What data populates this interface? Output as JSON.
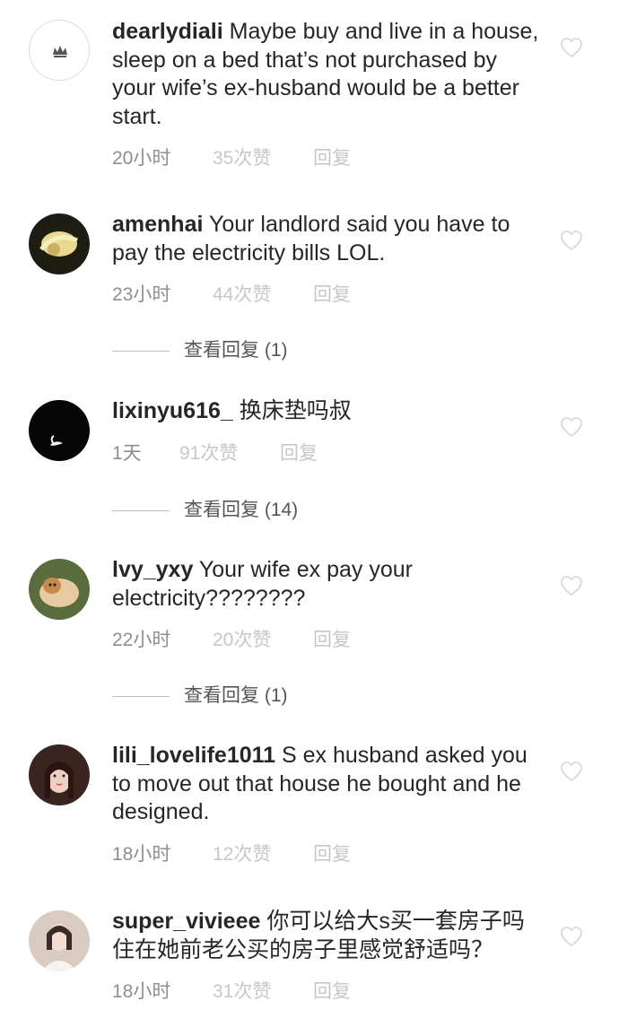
{
  "comments": [
    {
      "username": "dearlydiali",
      "text": "Maybe buy and live in a house, sleep on a bed that’s not purchased by your wife’s ex-husband would be a better start.",
      "time": "20小时",
      "likes": "35次赞",
      "reply": "回复"
    },
    {
      "username": "amenhai",
      "text": "Your landlord said you have to pay the electricity bills LOL.",
      "time": "23小时",
      "likes": "44次赞",
      "reply": "回复",
      "view_replies": "查看回复 (1)"
    },
    {
      "username": "lixinyu616_",
      "text": "换床垫吗叔",
      "time": "1天",
      "likes": "91次赞",
      "reply": "回复",
      "view_replies": "查看回复 (14)"
    },
    {
      "username": "lvy_yxy",
      "text": "Your wife ex pay your electricity????????",
      "time": "22小时",
      "likes": "20次赞",
      "reply": "回复",
      "view_replies": "查看回复 (1)"
    },
    {
      "username": "lili_lovelife1011",
      "text": "S ex husband asked you to move out that house he bought and he designed.",
      "time": "18小时",
      "likes": "12次赞",
      "reply": "回复"
    },
    {
      "username": "super_vivieee",
      "text": "你可以给大s买一套房子吗 住在她前老公买的房子里感觉舒适吗？",
      "time": "18小时",
      "likes": "31次赞",
      "reply": "回复"
    }
  ]
}
